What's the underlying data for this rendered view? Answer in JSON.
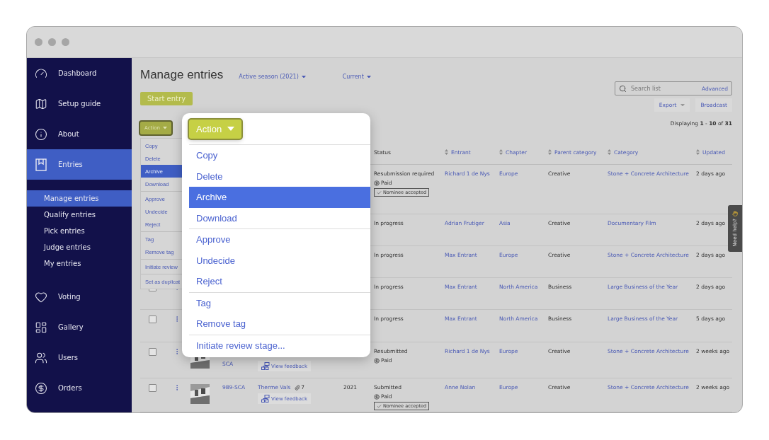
{
  "sidebar": {
    "items": [
      {
        "label": "Dashboard",
        "selected": false
      },
      {
        "label": "Setup guide",
        "selected": false
      },
      {
        "label": "About",
        "selected": false
      },
      {
        "label": "Entries",
        "selected": true,
        "children": [
          {
            "label": "Manage entries",
            "selected": true
          },
          {
            "label": "Qualify entries",
            "selected": false
          },
          {
            "label": "Pick entries",
            "selected": false
          },
          {
            "label": "Judge entries",
            "selected": false
          },
          {
            "label": "My entries",
            "selected": false
          }
        ]
      },
      {
        "label": "Voting",
        "selected": false
      },
      {
        "label": "Gallery",
        "selected": false
      },
      {
        "label": "Users",
        "selected": false
      },
      {
        "label": "Orders",
        "selected": false
      }
    ]
  },
  "header": {
    "title": "Manage entries",
    "filters": [
      "Active season (2021)",
      "Current"
    ],
    "start_button": "Start entry",
    "search": {
      "placeholder": "Search list",
      "advanced": "Advanced"
    },
    "buttons": [
      {
        "label": "Export",
        "kind": "dropdown"
      },
      {
        "label": "Broadcast",
        "kind": "plain"
      }
    ],
    "displaying": "Displaying **1** - **10** of **31**"
  },
  "action_menu": {
    "button": "Action",
    "groups": [
      {
        "items": [
          {
            "label": "Copy",
            "selected": false
          },
          {
            "label": "Delete",
            "selected": false
          },
          {
            "label": "Archive",
            "selected": true
          },
          {
            "label": "Download",
            "selected": false
          }
        ]
      },
      {
        "items": [
          {
            "label": "Approve",
            "selected": false
          },
          {
            "label": "Undecide",
            "selected": false
          },
          {
            "label": "Reject",
            "selected": false
          }
        ]
      },
      {
        "items": [
          {
            "label": "Tag",
            "selected": false
          },
          {
            "label": "Remove tag",
            "selected": false
          }
        ]
      },
      {
        "items": [
          {
            "label": "Initiate review",
            "selected": false
          }
        ]
      },
      {
        "items": [
          {
            "label": "Set as duplicat",
            "selected": false
          }
        ]
      }
    ]
  },
  "zoomed_menu": {
    "button": "Action",
    "groups": [
      {
        "items": [
          {
            "label": "Copy",
            "selected": false
          },
          {
            "label": "Delete",
            "selected": false
          },
          {
            "label": "Archive",
            "selected": true
          },
          {
            "label": "Download",
            "selected": false
          }
        ]
      },
      {
        "items": [
          {
            "label": "Approve",
            "selected": false
          },
          {
            "label": "Undecide",
            "selected": false
          },
          {
            "label": "Reject",
            "selected": false
          }
        ]
      },
      {
        "items": [
          {
            "label": "Tag",
            "selected": false
          },
          {
            "label": "Remove tag",
            "selected": false
          }
        ]
      },
      {
        "items": [
          {
            "label": "Initiate review stage..."
          }
        ]
      }
    ]
  },
  "table": {
    "columns": [
      {
        "label": "Status",
        "sortable": false
      },
      {
        "label": "Entrant",
        "sortable": true
      },
      {
        "label": "Chapter",
        "sortable": true
      },
      {
        "label": "Parent category",
        "sortable": true
      },
      {
        "label": "Category",
        "sortable": true
      },
      {
        "label": "Updated",
        "sortable": true
      }
    ],
    "rows": [
      {
        "status": "Resubmission required",
        "paid": "Paid",
        "badge": "Nominee accepted",
        "entrant": "Richard 1 de Nys",
        "chapter": "Europe",
        "parent_category": "Creative",
        "category": "Stone + Concrete Architecture",
        "updated": "2 days ago"
      },
      {
        "status": "In progress",
        "entrant": "Adrian Frutiger",
        "chapter": "Asia",
        "parent_category": "Creative",
        "category": "Documentary Film",
        "updated": "2 days ago"
      },
      {
        "status": "In progress",
        "entrant": "Max Entrant",
        "chapter": "Europe",
        "parent_category": "Creative",
        "category": "Stone + Concrete Architecture",
        "updated": "2 days ago"
      },
      {
        "checked": false,
        "status": "In progress",
        "entrant": "Max Entrant",
        "chapter": "North America",
        "parent_category": "Business",
        "category": "Large Business of the Year",
        "updated": "2 days ago"
      },
      {
        "checked": false,
        "status": "In progress",
        "entrant": "Max Entrant",
        "chapter": "North America",
        "parent_category": "Business",
        "category": "Large Business of the Year",
        "updated": "5 days ago"
      },
      {
        "checked": false,
        "thumbnail": true,
        "id_tail": "SCA",
        "feedback": "View feedback",
        "status": "Resubmitted",
        "paid": "Paid",
        "entrant": "Richard 1 de Nys",
        "chapter": "Europe",
        "parent_category": "Creative",
        "category": "Stone + Concrete Architecture",
        "updated": "2 weeks ago"
      },
      {
        "checked": false,
        "thumbnail": true,
        "id": "989-SCA",
        "title": "Therme Vals",
        "attachments": "7",
        "feedback": "View feedback",
        "year": "2021",
        "status": "Submitted",
        "paid": "Paid",
        "badge": "Nominee accepted",
        "entrant": "Anne Nolan",
        "chapter": "Europe",
        "parent_category": "Creative",
        "category": "Stone + Concrete Architecture",
        "updated": "2 weeks ago"
      }
    ]
  },
  "help_tab": {
    "label": "Need help?"
  }
}
